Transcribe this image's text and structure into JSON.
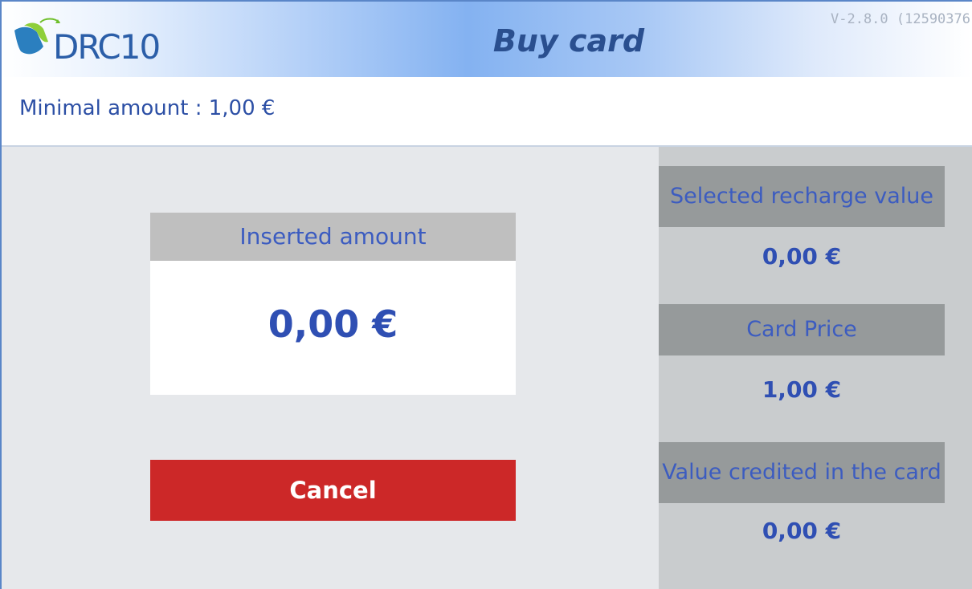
{
  "header": {
    "logo_text": "DRC10",
    "title": "Buy card",
    "version": "V-2.8.0 (12590376"
  },
  "info": {
    "minimal_amount": "Minimal amount : 1,00 €"
  },
  "inserted": {
    "label": "Inserted amount",
    "value": "0,00 €"
  },
  "actions": {
    "cancel_label": "Cancel"
  },
  "summary": {
    "selected_recharge_label": "Selected recharge value",
    "selected_recharge_value": "0,00  €",
    "card_price_label": "Card Price",
    "card_price_value": "1,00  €",
    "credited_label": "Value credited in the card",
    "credited_value": "0,00  €"
  },
  "colors": {
    "accent_text": "#2f4fb3",
    "cancel_button": "#cc2828",
    "panel_header": "#969a9b",
    "panel_bg": "#c9ccce"
  }
}
